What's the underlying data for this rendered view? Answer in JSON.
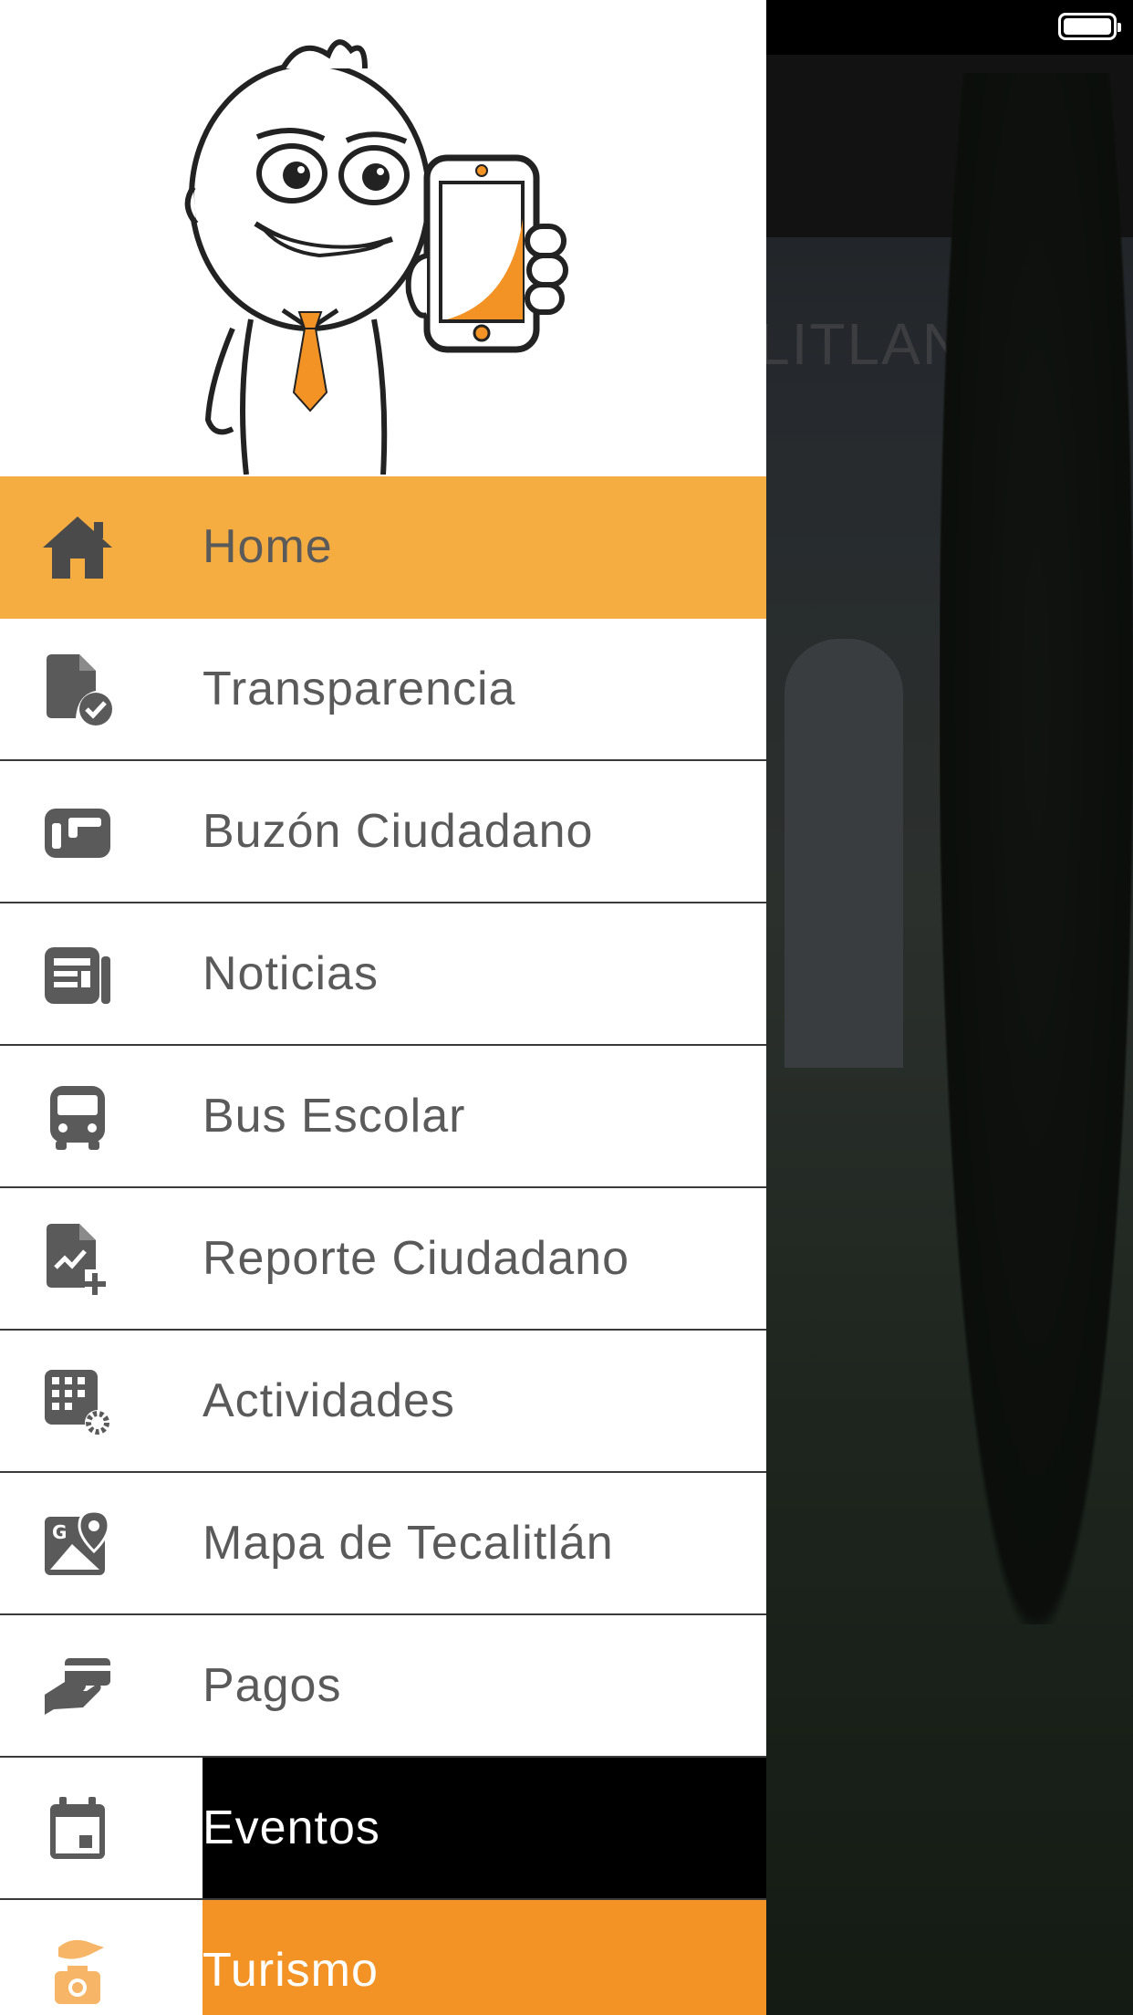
{
  "background": {
    "title_fragment": "LITLAN"
  },
  "menu": {
    "items": [
      {
        "label": "Home",
        "icon": "home-icon"
      },
      {
        "label": "Transparencia",
        "icon": "document-check-icon"
      },
      {
        "label": "Buzón Ciudadano",
        "icon": "mailbox-icon"
      },
      {
        "label": "Noticias",
        "icon": "newspaper-icon"
      },
      {
        "label": "Bus Escolar",
        "icon": "bus-icon"
      },
      {
        "label": "Reporte Ciudadano",
        "icon": "document-add-icon"
      },
      {
        "label": "Actividades",
        "icon": "calendar-grid-icon"
      },
      {
        "label": "Mapa de Tecalitlán",
        "icon": "map-icon"
      },
      {
        "label": "Pagos",
        "icon": "payments-icon"
      },
      {
        "label": "Eventos",
        "icon": "calendar-icon"
      },
      {
        "label": "Turismo",
        "icon": "tourist-icon"
      }
    ]
  },
  "colors": {
    "accent_orange": "#f39325",
    "active_item": "#f5ad42",
    "icon_gray": "#5a5a5a"
  }
}
